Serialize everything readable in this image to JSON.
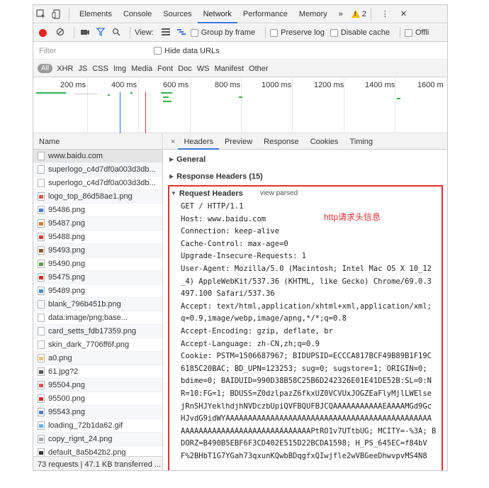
{
  "tabbar": {
    "tabs": [
      "Elements",
      "Console",
      "Sources",
      "Network",
      "Performance",
      "Memory"
    ],
    "active": "Network",
    "more": "»",
    "warnings": "2",
    "menu": "⋮",
    "close": "✕"
  },
  "toolbar": {
    "view_label": "View:",
    "group_by_frame": "Group by frame",
    "preserve_log": "Preserve log",
    "disable_cache": "Disable cache",
    "offline": "Offli"
  },
  "filter": {
    "placeholder": "Filter",
    "hide_data_urls": "Hide data URLs"
  },
  "types": {
    "all": "All",
    "items": [
      "XHR",
      "JS",
      "CSS",
      "Img",
      "Media",
      "Font",
      "Doc",
      "WS",
      "Manifest",
      "Other"
    ]
  },
  "timeline": {
    "ticks": [
      "200 ms",
      "400 ms",
      "600 ms",
      "800 ms",
      "1000 ms",
      "1200 ms",
      "1400 ms",
      "1600 m"
    ]
  },
  "requests": {
    "header": "Name",
    "items": [
      {
        "name": "www.baidu.com",
        "icon": "document-icon",
        "color": "#ffffff"
      },
      {
        "name": "superlogo_c4d7df0a003d3db...",
        "icon": "document-icon",
        "color": "#ffffff"
      },
      {
        "name": "superlogo_c4d7df0a003d3db...",
        "icon": "document-icon",
        "color": "#ffffff"
      },
      {
        "name": "logo_top_86d58ae1.png",
        "icon": "image-icon",
        "color": "#d9534f"
      },
      {
        "name": "95486.png",
        "icon": "image-icon",
        "color": "#4a7fd9"
      },
      {
        "name": "95487.png",
        "icon": "image-icon",
        "color": "#e07b39"
      },
      {
        "name": "95488.png",
        "icon": "image-icon",
        "color": "#d63a3a"
      },
      {
        "name": "95493.png",
        "icon": "image-icon",
        "color": "#8a5a2b"
      },
      {
        "name": "95490.png",
        "icon": "image-icon",
        "color": "#5aa548"
      },
      {
        "name": "95475.png",
        "icon": "image-icon",
        "color": "#c9302c"
      },
      {
        "name": "95489.png",
        "icon": "image-icon",
        "color": "#3d8fd6"
      },
      {
        "name": "blank_796b451b.png",
        "icon": "document-icon",
        "color": "#ffffff"
      },
      {
        "name": "data:image/png;base...",
        "icon": "document-icon",
        "color": "#ffffff"
      },
      {
        "name": "card_setts_fdb17359.png",
        "icon": "document-icon",
        "color": "#ffffff"
      },
      {
        "name": "skin_dark_7706ff6f.png",
        "icon": "document-icon",
        "color": "#ffffff"
      },
      {
        "name": "a0.png",
        "icon": "image-icon",
        "color": "#f0c070"
      },
      {
        "name": "61.jpg?2",
        "icon": "image-icon",
        "color": "#555555"
      },
      {
        "name": "95504.png",
        "icon": "image-icon",
        "color": "#d9534f"
      },
      {
        "name": "95500.png",
        "icon": "image-icon",
        "color": "#c9302c"
      },
      {
        "name": "95543.png",
        "icon": "image-icon",
        "color": "#4a7fd9"
      },
      {
        "name": "loading_72b1da62.gif",
        "icon": "image-icon",
        "color": "#6ab0e0"
      },
      {
        "name": "copy_rignt_24.png",
        "icon": "image-icon",
        "color": "#aaaaaa"
      },
      {
        "name": "default_8a5b42b2.png",
        "icon": "image-icon",
        "color": "#333333"
      }
    ],
    "summary": "73 requests | 47.1 KB transferred ..."
  },
  "detail": {
    "close": "×",
    "tabs": [
      "Headers",
      "Preview",
      "Response",
      "Cookies",
      "Timing"
    ],
    "active": "Headers",
    "general": "General",
    "response_headers": "Response Headers (15)",
    "request_headers": "Request Headers",
    "view_parsed": "view parsed",
    "annotation": "http请求头信息",
    "lines": [
      "GET / HTTP/1.1",
      "Host: www.baidu.com",
      "Connection: keep-alive",
      "Cache-Control: max-age=0",
      "Upgrade-Insecure-Requests: 1",
      "User-Agent: Mozilla/5.0 (Macintosh; Intel Mac OS X 10_12",
      "_4) AppleWebKit/537.36 (KHTML, like Gecko) Chrome/69.0.3",
      "497.100 Safari/537.36",
      "Accept: text/html,application/xhtml+xml,application/xml;",
      "q=0.9,image/webp,image/apng,*/*;q=0.8",
      "Accept-Encoding: gzip, deflate, br",
      "Accept-Language: zh-CN,zh;q=0.9",
      "Cookie: PSTM=1506687967; BIDUPSID=ECCCA817BCF49B89B1F19C",
      "6185C20BAC; BD_UPN=123253; sug=0; sugstore=1; ORIGIN=0;",
      "bdime=0; BAIDUID=990D38B58C25B6D242326E01E41DE52B:SL=0:N",
      "R=10:FG=1; BDUSS=Z0dzlpazZ6fkxUZ0VCVUxJOGZEaFlyMjlLWElse",
      "jRnSHJYeklhdjhNVDczbUpiQVFBQUFBJCQAAAAAAAAAAAEAAAAMGd9Gc",
      "HJvdG9idWYAAAAAAAAAAAAAAAAAAAAAAAAAAAAAAAAAAAAAAAAAAAAAA",
      "AAAAAAAAAAAAAAAAAAAAAAAAAAAAAPtRO1v7UTtbUG; MCITY=-%3A; B",
      "DORZ=B490B5EBF6F3CD402E515D22BCDA1598; H_PS_645EC=f84bV",
      "F%2BHbT1G7YGah73qxunKQwbBDqgfxQIwjfle2wVBGeeDhwvpvMS4N8"
    ]
  }
}
